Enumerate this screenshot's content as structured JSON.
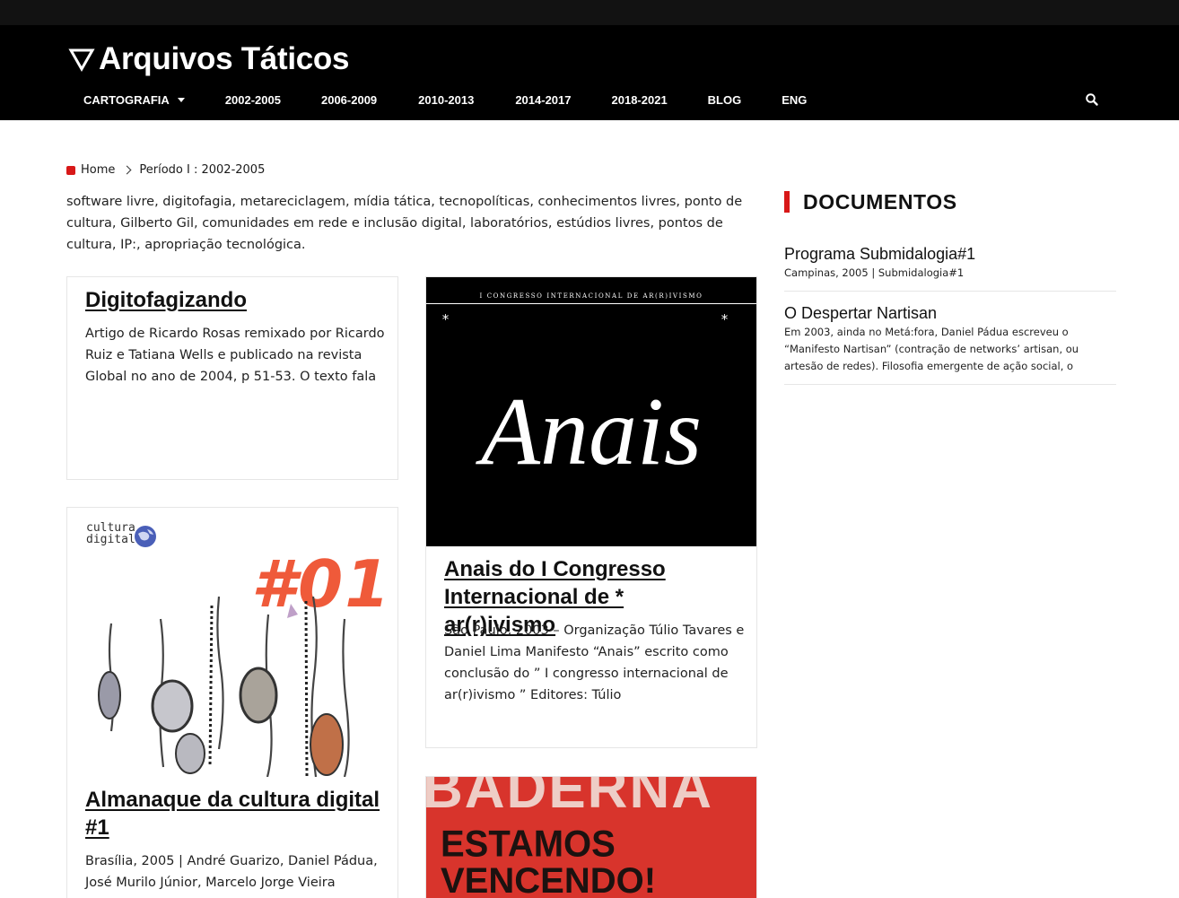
{
  "site": {
    "title": "Arquivos Táticos",
    "logo_icon": "triangle-down-icon"
  },
  "nav": {
    "items": [
      {
        "label": "CARTOGRAFIA",
        "has_dropdown": true
      },
      {
        "label": "2002-2005"
      },
      {
        "label": "2006-2009"
      },
      {
        "label": "2010-2013"
      },
      {
        "label": "2014-2017"
      },
      {
        "label": "2018-2021"
      },
      {
        "label": "BLOG"
      },
      {
        "label": "ENG"
      }
    ],
    "search_icon": "search-icon"
  },
  "breadcrumb": {
    "home": "Home",
    "current": "Período I : 2002-2005"
  },
  "intro": "software livre, digitofagia, metareciclagem, mídia tática, tecnopolíticas, conhecimentos livres, ponto de cultura, Gilberto Gil, comunidades em rede e inclusão digital, laboratórios, estúdios livres, pontos de cultura, IP:, apropriação tecnológica.",
  "posts": [
    {
      "title": "Digitofagizando",
      "excerpt": "Artigo de Ricardo Rosas remixado por Ricardo Ruiz e Tatiana Wells e publicado na revista Global no ano de 2004, p 51-53. O texto fala"
    },
    {
      "title": "Anais do I Congresso Internacional de * ar(r)ivismo",
      "excerpt": "São Paulo, 2003 – Organização Túlio Tavares e Daniel Lima Manifesto “Anais” escrito como conclusão do ” I congresso internacional de ar(r)ivismo ” Editores: Túlio",
      "image_header": "I CONGRESSO INTERNACIONAL DE AR(R)IVISMO",
      "image_word": "Anais",
      "image_star": "*"
    },
    {
      "title": "Almanaque da cultura digital #1",
      "excerpt": "Brasília, 2005 | André Guarizo, Daniel Pádua, José Murilo Júnior, Marcelo Jorge Vieira",
      "image_logo_line1": "cultura",
      "image_logo_line2": "digital",
      "image_number": "#01"
    },
    {
      "title": "",
      "image_line1": "BADERNA",
      "image_line2": "ESTAMOS",
      "image_line3": "VENCENDO!"
    }
  ],
  "sidebar": {
    "heading": "DOCUMENTOS",
    "items": [
      {
        "title": "Programa Submidalogia#1",
        "meta": "Campinas, 2005 | Submidalogia#1"
      },
      {
        "title": "O Despertar Nartisan",
        "meta": "Em 2003, ainda no Metá:fora, Daniel Pádua escreveu o “Manifesto Nartisan” (contração de networks’ artisan, ou artesão de redes). Filosofia emergente de ação social, o"
      }
    ]
  },
  "colors": {
    "accent": "#d81818",
    "header_bg": "#000000",
    "topbar_bg": "#121212"
  }
}
